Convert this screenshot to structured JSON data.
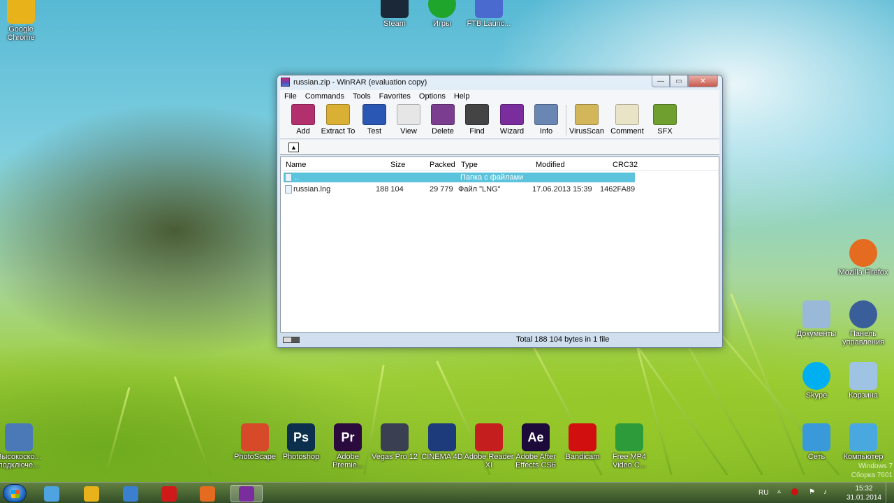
{
  "desktop": {
    "icons_top": [
      {
        "label": "Google Chrome",
        "icon": "chrome-icon",
        "color": "#e8b31a"
      },
      {
        "label": "Steam",
        "icon": "steam-icon",
        "color": "#1b2838"
      },
      {
        "label": "Игры",
        "icon": "games-icon",
        "color": "#1fa52c"
      },
      {
        "label": "FTB Launc...",
        "icon": "ftb-icon",
        "color": "#4a6ad0"
      }
    ],
    "icons_right": [
      {
        "label": "Mozilla Firefox",
        "icon": "firefox-icon",
        "color": "#e46b1f"
      },
      {
        "label": "Документы",
        "icon": "documents-icon",
        "color": "#9ab8d8"
      },
      {
        "label": "Панель управления",
        "icon": "control-panel-icon",
        "color": "#3a5e9a"
      },
      {
        "label": "Skype",
        "icon": "skype-icon",
        "color": "#00aff0"
      },
      {
        "label": "Корзина",
        "icon": "recycle-bin-icon",
        "color": "#9fc3e3"
      },
      {
        "label": "Сеть",
        "icon": "network-icon",
        "color": "#3a9ad9"
      },
      {
        "label": "Компьютер",
        "icon": "computer-icon",
        "color": "#4aa8e0"
      }
    ],
    "icons_bottom": [
      {
        "label": "Высокоско... подключе...",
        "icon": "broadband-connection-icon",
        "color": "#4b79b8"
      },
      {
        "label": "PhotoScape",
        "icon": "photoscape-icon",
        "color": "#d64a2a"
      },
      {
        "label": "Photoshop",
        "icon": "photoshop-icon",
        "color": "#0b2f4d",
        "text": "Ps"
      },
      {
        "label": "Adobe Premie...",
        "icon": "premiere-icon",
        "color": "#2b0a3d",
        "text": "Pr"
      },
      {
        "label": "Vegas Pro 12",
        "icon": "vegas-icon",
        "color": "#3a3f52"
      },
      {
        "label": "CINEMA 4D",
        "icon": "cinema4d-icon",
        "color": "#1d3b7a"
      },
      {
        "label": "Adobe Reader XI",
        "icon": "adobe-reader-icon",
        "color": "#c41e1e"
      },
      {
        "label": "Adobe After Effects CS6",
        "icon": "after-effects-icon",
        "color": "#1c0a3a",
        "text": "Ae"
      },
      {
        "label": "Bandicam",
        "icon": "bandicam-icon",
        "color": "#d10f0f"
      },
      {
        "label": "Free MP4 Video C...",
        "icon": "mp4-converter-icon",
        "color": "#2e9b3a"
      }
    ]
  },
  "window": {
    "title": "russian.zip - WinRAR (evaluation copy)",
    "buttons": {
      "minimize": "—",
      "maximize": "▭",
      "close": "✕"
    },
    "menu": [
      "File",
      "Commands",
      "Tools",
      "Favorites",
      "Options",
      "Help"
    ],
    "toolbar": [
      {
        "label": "Add",
        "icon": "add-archive-icon",
        "color": "#b3306e"
      },
      {
        "label": "Extract To",
        "icon": "extract-folder-icon",
        "color": "#d9b033"
      },
      {
        "label": "Test",
        "icon": "test-icon",
        "color": "#2a57b3"
      },
      {
        "label": "View",
        "icon": "view-book-icon",
        "color": "#e6e6e6"
      },
      {
        "label": "Delete",
        "icon": "delete-icon",
        "color": "#7a3d8f"
      },
      {
        "label": "Find",
        "icon": "binoculars-icon",
        "color": "#444444"
      },
      {
        "label": "Wizard",
        "icon": "wizard-icon",
        "color": "#7a2e9e"
      },
      {
        "label": "Info",
        "icon": "info-icon",
        "color": "#6a86b3"
      },
      {
        "label": "VirusScan",
        "icon": "virus-scan-icon",
        "color": "#d3b55a"
      },
      {
        "label": "Comment",
        "icon": "comment-icon",
        "color": "#e9e3c7"
      },
      {
        "label": "SFX",
        "icon": "sfx-icon",
        "color": "#6f9f2e"
      }
    ],
    "up_button": "▲",
    "columns": {
      "name": "Name",
      "size": "Size",
      "packed": "Packed",
      "type": "Type",
      "modified": "Modified",
      "crc": "CRC32"
    },
    "rows": [
      {
        "name": "..",
        "size": "",
        "packed": "",
        "type": "Папка с файлами",
        "modified": "",
        "crc": ""
      },
      {
        "name": "russian.lng",
        "size": "188 104",
        "packed": "29 779",
        "type": "Файл \"LNG\"",
        "modified": "17.06.2013 15:39",
        "crc": "1462FA89"
      }
    ],
    "status": "Total 188 104 bytes in 1 file"
  },
  "taskbar": {
    "apps": [
      {
        "name": "explorer",
        "icon": "explorer-icon",
        "color": "#4fa3e0"
      },
      {
        "name": "chrome",
        "icon": "chrome-icon",
        "color": "#e8b31a"
      },
      {
        "name": "media",
        "icon": "media-player-icon",
        "color": "#3a7fd0"
      },
      {
        "name": "opera",
        "icon": "opera-icon",
        "color": "#d01a1a"
      },
      {
        "name": "firefox",
        "icon": "firefox-icon",
        "color": "#e46b1f"
      },
      {
        "name": "winrar",
        "icon": "winrar-icon",
        "color": "#7a2e9e"
      }
    ],
    "lang": "RU",
    "time": "15:32",
    "date": "31.01.2014",
    "watermark": "Windows 7\nСборка 7601"
  }
}
